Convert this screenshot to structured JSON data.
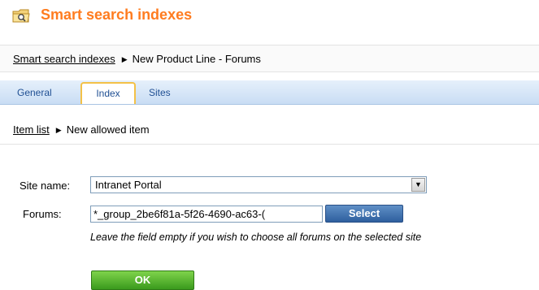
{
  "header": {
    "title": "Smart search indexes",
    "icon": "folder-search-icon",
    "title_color": "#ff7c1f"
  },
  "breadcrumb": {
    "root_link": "Smart search indexes",
    "current": "New Product Line - Forums"
  },
  "tabs": [
    {
      "label": "General",
      "active": false
    },
    {
      "label": "Index",
      "active": true
    },
    {
      "label": "Sites",
      "active": false
    }
  ],
  "subcrumb": {
    "link": "Item list",
    "current": "New allowed item"
  },
  "form": {
    "site_name_label": "Site name:",
    "site_name_value": "Intranet Portal",
    "forums_label": "Forums:",
    "forums_value": "*_group_2be6f81a-5f26-4690-ac63-(",
    "select_button": "Select",
    "hint": "Leave the field empty if you wish to choose all forums on the selected site"
  },
  "actions": {
    "ok_label": "OK"
  }
}
